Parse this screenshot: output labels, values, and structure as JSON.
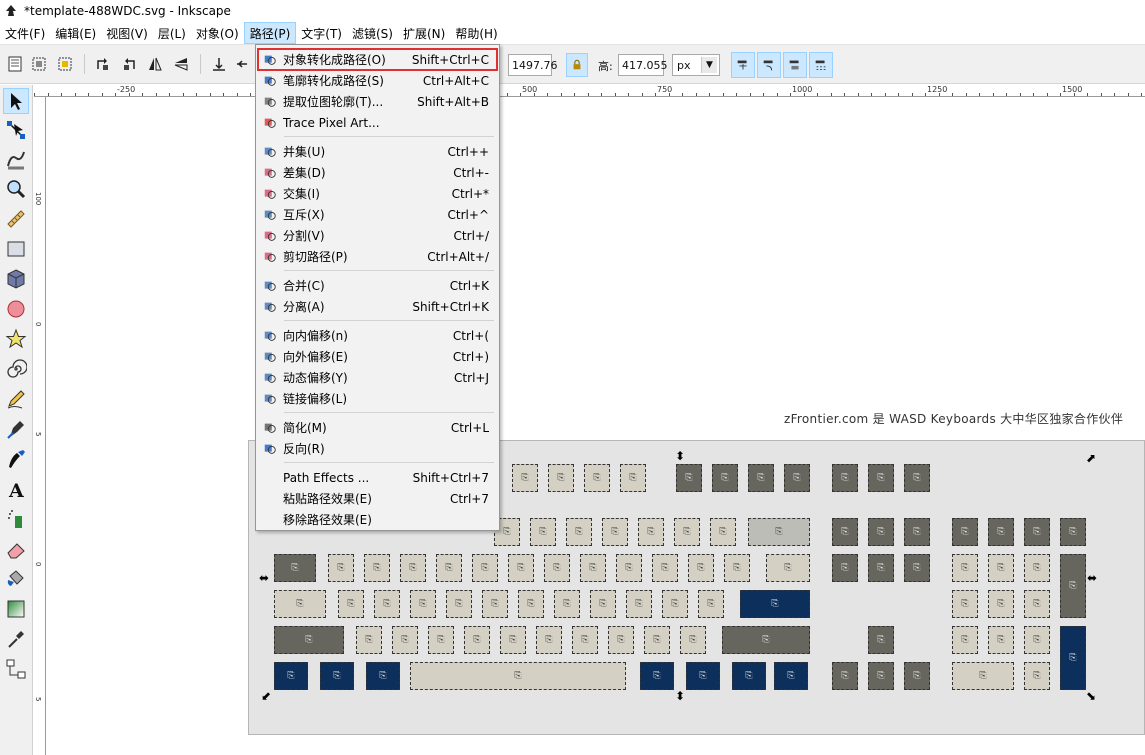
{
  "window": {
    "title": "*template-488WDC.svg - Inkscape"
  },
  "menubar": [
    {
      "label": "文件(F)",
      "active": false
    },
    {
      "label": "编辑(E)",
      "active": false
    },
    {
      "label": "视图(V)",
      "active": false
    },
    {
      "label": "层(L)",
      "active": false
    },
    {
      "label": "对象(O)",
      "active": false
    },
    {
      "label": "路径(P)",
      "active": true
    },
    {
      "label": "文字(T)",
      "active": false
    },
    {
      "label": "滤镜(S)",
      "active": false
    },
    {
      "label": "扩展(N)",
      "active": false
    },
    {
      "label": "帮助(H)",
      "active": false
    }
  ],
  "toolbar": {
    "w_value": "1497.76",
    "h_label": "高:",
    "h_value": "417.055",
    "unit": "px"
  },
  "ruler": {
    "h_labels": [
      "-250",
      "500",
      "750",
      "1000",
      "1250",
      "1500"
    ]
  },
  "canvas": {
    "credit_text": "zFrontier.com 是 WASD Keyboards 大中华区独家合作伙伴"
  },
  "path_menu": {
    "items": [
      {
        "label": "对象转化成路径(O)",
        "shortcut": "Shift+Ctrl+C",
        "icon": "object-to-path-icon",
        "highlight": true
      },
      {
        "label": "笔廓转化成路径(S)",
        "shortcut": "Ctrl+Alt+C",
        "icon": "stroke-to-path-icon"
      },
      {
        "label": "提取位图轮廓(T)...",
        "shortcut": "Shift+Alt+B",
        "icon": "trace-bitmap-icon"
      },
      {
        "label": "Trace Pixel Art...",
        "shortcut": "",
        "icon": "trace-pixel-art-icon"
      },
      {
        "sep": true
      },
      {
        "label": "并集(U)",
        "shortcut": "Ctrl++",
        "icon": "union-icon"
      },
      {
        "label": "差集(D)",
        "shortcut": "Ctrl+-",
        "icon": "difference-icon"
      },
      {
        "label": "交集(I)",
        "shortcut": "Ctrl+*",
        "icon": "intersection-icon"
      },
      {
        "label": "互斥(X)",
        "shortcut": "Ctrl+^",
        "icon": "exclusion-icon"
      },
      {
        "label": "分割(V)",
        "shortcut": "Ctrl+/",
        "icon": "division-icon"
      },
      {
        "label": "剪切路径(P)",
        "shortcut": "Ctrl+Alt+/",
        "icon": "cut-path-icon"
      },
      {
        "sep": true
      },
      {
        "label": "合并(C)",
        "shortcut": "Ctrl+K",
        "icon": "combine-icon"
      },
      {
        "label": "分离(A)",
        "shortcut": "Shift+Ctrl+K",
        "icon": "break-apart-icon"
      },
      {
        "sep": true
      },
      {
        "label": "向内偏移(n)",
        "shortcut": "Ctrl+(",
        "icon": "inset-icon"
      },
      {
        "label": "向外偏移(E)",
        "shortcut": "Ctrl+)",
        "icon": "outset-icon"
      },
      {
        "label": "动态偏移(Y)",
        "shortcut": "Ctrl+J",
        "icon": "dynamic-offset-icon"
      },
      {
        "label": "链接偏移(L)",
        "shortcut": "",
        "icon": "linked-offset-icon"
      },
      {
        "sep": true
      },
      {
        "label": "简化(M)",
        "shortcut": "Ctrl+L",
        "icon": "simplify-icon"
      },
      {
        "label": "反向(R)",
        "shortcut": "",
        "icon": "reverse-icon"
      },
      {
        "sep": true
      },
      {
        "label": "Path Effects ...",
        "shortcut": "Shift+Ctrl+7",
        "icon": ""
      },
      {
        "label": "粘贴路径效果(E)",
        "shortcut": "Ctrl+7",
        "icon": ""
      },
      {
        "label": "移除路径效果(E)",
        "shortcut": "",
        "icon": ""
      }
    ]
  }
}
